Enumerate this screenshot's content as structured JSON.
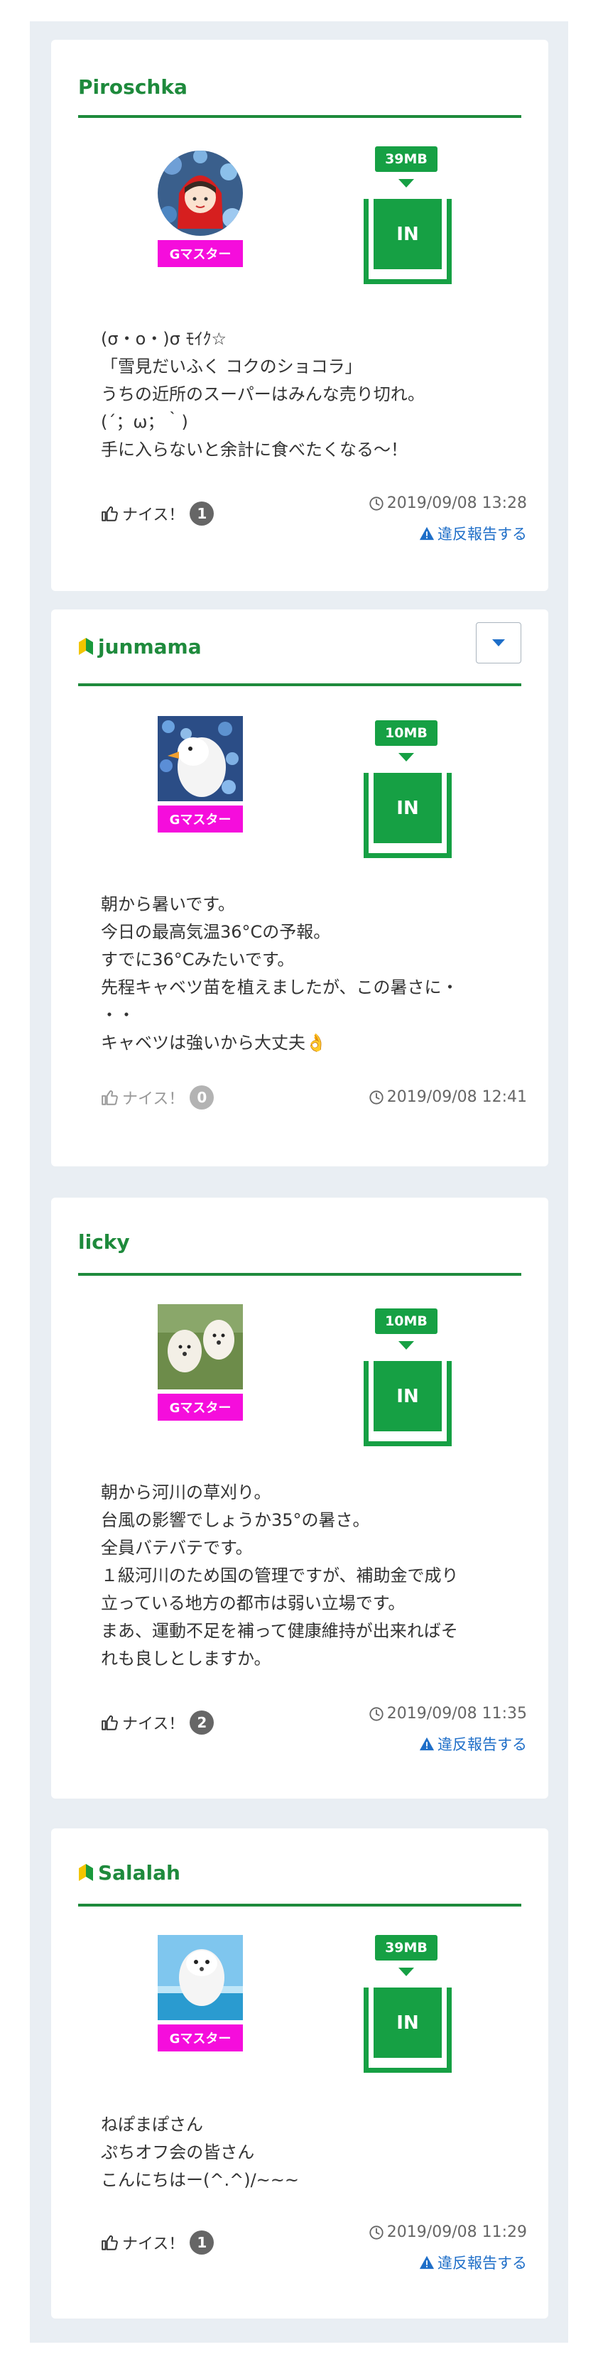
{
  "posts": [
    {
      "username": "Piroschka",
      "beginner": false,
      "has_menu": false,
      "rank": "Gマスター",
      "bandwidth": "39MB",
      "status": "IN",
      "body": "(σ・o・)σ ﾓｲｸ☆\n「雪見だいふく コクのショコラ」\nうちの近所のスーパーはみんな売り切れ。\n(´；ω；｀)\n手に入らないと余計に食べたくなる〜！",
      "like_label": "ナイス！",
      "like_count": "1",
      "timestamp": "2019/09/08 13:28",
      "report_label": "違反報告する"
    },
    {
      "username": "junmama",
      "beginner": true,
      "has_menu": true,
      "rank": "Gマスター",
      "bandwidth": "10MB",
      "status": "IN",
      "body": "朝から暑いです。\n今日の最高気温36°Cの予報。\nすでに36°Cみたいです。\n先程キャベツ苗を植えましたが、この暑さに・\n・・\nキャベツは強いから大丈夫👌",
      "like_label": "ナイス！",
      "like_count": "0",
      "timestamp": "2019/09/08 12:41",
      "report_label": ""
    },
    {
      "username": "licky",
      "beginner": false,
      "has_menu": false,
      "rank": "Gマスター",
      "bandwidth": "10MB",
      "status": "IN",
      "body": "朝から河川の草刈り。\n台風の影響でしょうか35°の暑さ。\n全員バテバテです。\n１級河川のため国の管理ですが、補助金で成り\n立っている地方の都市は弱い立場です。\nまあ、運動不足を補って健康維持が出来ればそ\nれも良しとしますか。",
      "like_label": "ナイス！",
      "like_count": "2",
      "timestamp": "2019/09/08 11:35",
      "report_label": "違反報告する"
    },
    {
      "username": "Salalah",
      "beginner": true,
      "has_menu": false,
      "rank": "Gマスター",
      "bandwidth": "39MB",
      "status": "IN",
      "body": "ねぽまぽさん\nぷちオフ会の皆さん\nこんにちはー(^.^)/~~~",
      "like_label": "ナイス！",
      "like_count": "1",
      "timestamp": "2019/09/08 11:29",
      "report_label": "違反報告する"
    }
  ]
}
